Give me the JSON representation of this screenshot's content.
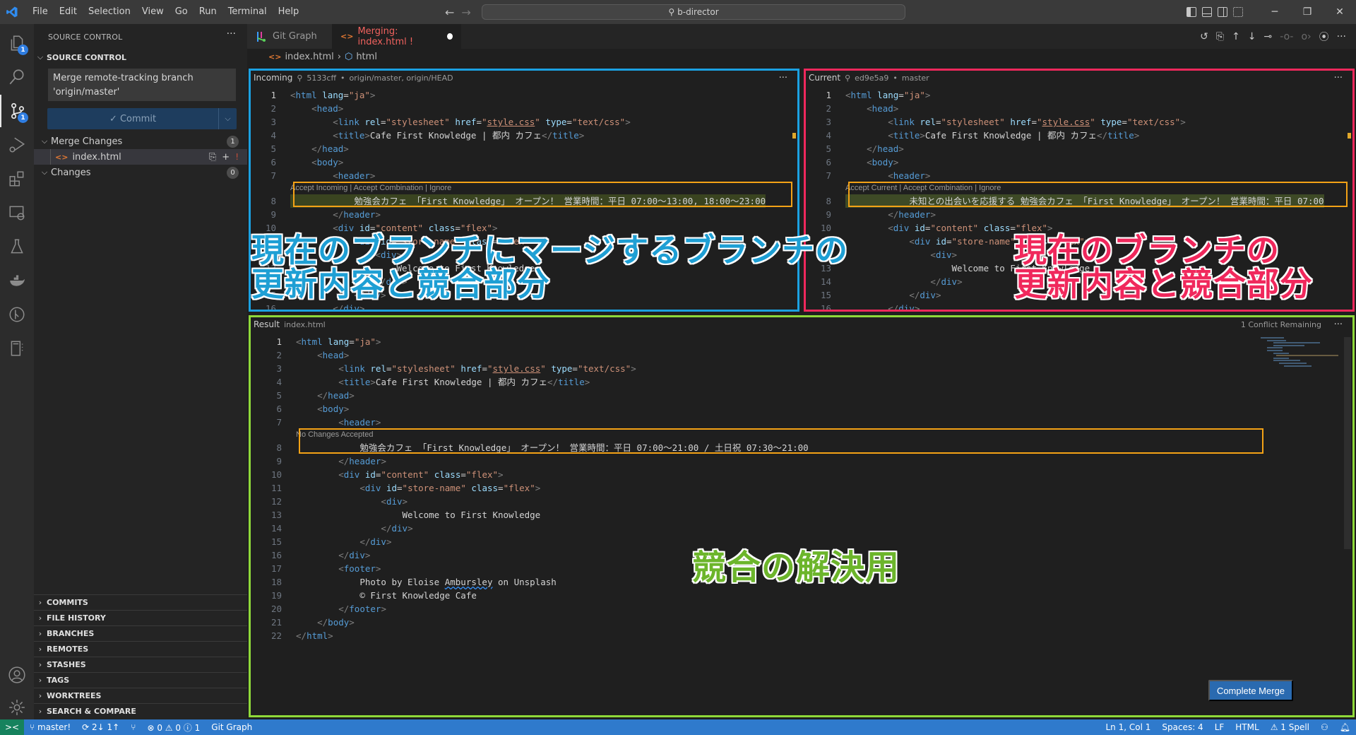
{
  "titlebar": {
    "menu": [
      "File",
      "Edit",
      "Selection",
      "View",
      "Go",
      "Run",
      "Terminal",
      "Help"
    ],
    "search": "b-director",
    "window_controls": [
      "minimize",
      "restore",
      "close"
    ]
  },
  "activitybar": {
    "items": [
      {
        "name": "explorer",
        "badge": "1"
      },
      {
        "name": "search",
        "badge": null
      },
      {
        "name": "source-control",
        "badge": "1",
        "active": true
      },
      {
        "name": "run-debug",
        "badge": null
      },
      {
        "name": "extensions",
        "badge": null
      },
      {
        "name": "remote-explorer",
        "badge": null
      },
      {
        "name": "testing",
        "badge": null
      },
      {
        "name": "docker",
        "badge": null
      },
      {
        "name": "gitlens",
        "badge": null
      },
      {
        "name": "remote-tunnel",
        "badge": null
      }
    ],
    "bottom": [
      "accounts",
      "manage"
    ]
  },
  "sidebar": {
    "title": "SOURCE CONTROL",
    "section": "SOURCE CONTROL",
    "commit_message": "Merge remote-tracking branch 'origin/master'",
    "commit_label": "✓ Commit",
    "merge_changes": {
      "label": "Merge Changes",
      "count": "1"
    },
    "merge_file": "index.html",
    "changes": {
      "label": "Changes",
      "count": "0"
    },
    "lower_sections": [
      "COMMITS",
      "FILE HISTORY",
      "BRANCHES",
      "REMOTES",
      "STASHES",
      "TAGS",
      "WORKTREES",
      "SEARCH & COMPARE"
    ]
  },
  "tabs": [
    {
      "label": "Git Graph"
    },
    {
      "label": "Merging: index.html !",
      "modified": true
    }
  ],
  "breadcrumb": [
    "index.html",
    "html"
  ],
  "incoming": {
    "title": "Incoming",
    "commit": "5133cff",
    "refs": "origin/master, origin/HEAD",
    "codelens": "Accept Incoming | Accept Combination | Ignore",
    "conflict_line": "勉強会カフェ 「First Knowledge」 オープン！ 営業時間：平日 07:00〜13:00, 18:00〜23:00"
  },
  "current": {
    "title": "Current",
    "commit": "ed9e5a9",
    "refs": "master",
    "codelens": "Accept Current | Accept Combination | Ignore",
    "conflict_line": "未知との出会いを応援する 勉強会カフェ 「First Knowledge」 オープン！ 営業時間：平日 07:00"
  },
  "result": {
    "title": "Result",
    "file": "index.html",
    "remaining": "1 Conflict Remaining",
    "codelens": "No Changes Accepted",
    "conflict_line": "勉強会カフェ 「First Knowledge」 オープン！ 営業時間：平日 07:00〜21:00 / 土日祝 07:30〜21:00",
    "complete_label": "Complete Merge"
  },
  "code": {
    "l1": "html",
    "l1_attr": "lang",
    "l1_val": "\"ja\"",
    "head": "head",
    "link": "link",
    "rel": "rel",
    "rel_val": "\"stylesheet\"",
    "href": "href",
    "href_val": "style.css",
    "type": "type",
    "type_val": "\"text/css\"",
    "title_tag": "title",
    "title_text": "Cafe First Knowledge | 都内 カフェ",
    "body": "body",
    "header": "header",
    "div": "div",
    "id": "id",
    "content_val": "\"content\"",
    "class": "class",
    "flex_val": "\"flex\"",
    "store_val": "\"store-name\"",
    "welcome": "Welcome to First Knowledge",
    "footer": "footer",
    "photo_pre": "Photo by Eloise ",
    "photo_name": "Ambursley",
    "photo_post": " on Unsplash",
    "copyright": "© First Knowledge Cafe"
  },
  "annotations": {
    "incoming": [
      "現在のブランチにマージするブランチの",
      "更新内容と競合部分"
    ],
    "current": [
      "現在のブランチの",
      "更新内容と競合部分"
    ],
    "result": "競合の解決用"
  },
  "colors": {
    "incoming_border": "#1ba1e2",
    "current_border": "#f0285c",
    "result_border": "#8fd93a",
    "conflict_box": "#f3a216",
    "status_bar": "#2f7acc"
  },
  "statusbar": {
    "branch": "master!",
    "sync": "2↓ 1↑",
    "problems": "0",
    "warnings": "0",
    "info": "1",
    "git_graph": "Git Graph",
    "position": "Ln 1, Col 1",
    "spaces": "Spaces: 4",
    "eol": "LF",
    "language": "HTML",
    "spell": "1 Spell"
  }
}
